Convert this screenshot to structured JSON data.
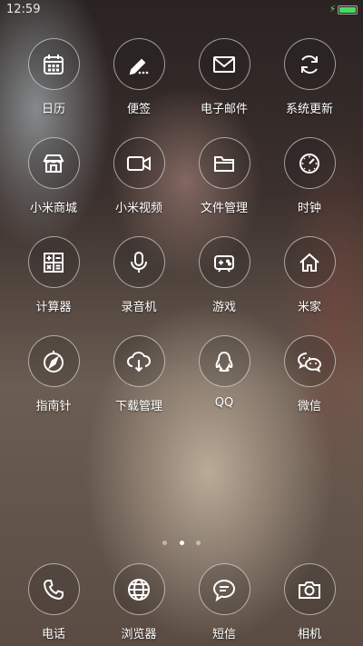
{
  "status_bar": {
    "time": "12:59",
    "charging_symbol": "⚡",
    "battery_level": 1.0,
    "battery_color": "#4bd964"
  },
  "apps": [
    {
      "label": "日历",
      "icon": "calendar-icon"
    },
    {
      "label": "便签",
      "icon": "notes-pen-icon"
    },
    {
      "label": "电子邮件",
      "icon": "mail-icon"
    },
    {
      "label": "系统更新",
      "icon": "refresh-icon"
    },
    {
      "label": "小米商城",
      "icon": "store-icon"
    },
    {
      "label": "小米视频",
      "icon": "video-icon"
    },
    {
      "label": "文件管理",
      "icon": "folder-icon"
    },
    {
      "label": "时钟",
      "icon": "clock-icon"
    },
    {
      "label": "计算器",
      "icon": "calculator-icon"
    },
    {
      "label": "录音机",
      "icon": "microphone-icon"
    },
    {
      "label": "游戏",
      "icon": "gamepad-icon"
    },
    {
      "label": "米家",
      "icon": "home-icon"
    },
    {
      "label": "指南针",
      "icon": "compass-icon"
    },
    {
      "label": "下载管理",
      "icon": "cloud-download-icon"
    },
    {
      "label": "QQ",
      "icon": "qq-penguin-icon"
    },
    {
      "label": "微信",
      "icon": "wechat-icon"
    }
  ],
  "page_indicator": {
    "count": 3,
    "active_index": 1
  },
  "dock": [
    {
      "label": "电话",
      "icon": "phone-icon"
    },
    {
      "label": "浏览器",
      "icon": "globe-icon"
    },
    {
      "label": "短信",
      "icon": "message-icon"
    },
    {
      "label": "相机",
      "icon": "camera-icon"
    }
  ]
}
